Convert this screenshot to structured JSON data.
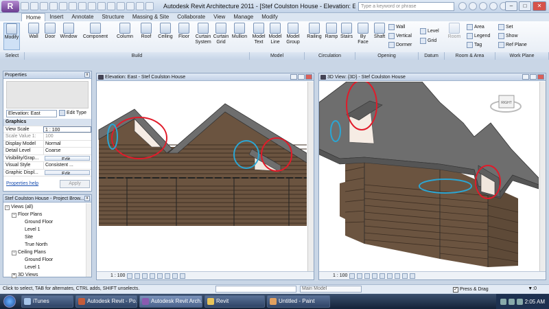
{
  "title_bar": {
    "app_logo": "R",
    "title": "Autodesk Revit Architecture 2011 - [Stef Coulston House - Elevation: E",
    "search_placeholder": "Type a keyword or phrase"
  },
  "tabs": [
    "Home",
    "Insert",
    "Annotate",
    "Structure",
    "Massing & Site",
    "Collaborate",
    "View",
    "Manage",
    "Modify"
  ],
  "ribbon": {
    "select": {
      "modify": "Modify"
    },
    "build": {
      "wall": "Wall",
      "door": "Door",
      "window": "Window",
      "component": "Component",
      "column": "Column",
      "roof": "Roof",
      "ceiling": "Ceiling",
      "floor": "Floor",
      "curtain_system": "Curtain System",
      "curtain_grid": "Curtain Grid",
      "mullion": "Mullion"
    },
    "model": {
      "model_text": "Model Text",
      "model_line": "Model Line",
      "model_group": "Model Group"
    },
    "circulation": {
      "railing": "Railing",
      "ramp": "Ramp",
      "stairs": "Stairs"
    },
    "opening": {
      "by_face": "By Face",
      "shaft": "Shaft",
      "wall": "Wall",
      "vertical": "Vertical",
      "dormer": "Dormer"
    },
    "datum": {
      "level": "Level",
      "grid": "Grid"
    },
    "room_area": {
      "room": "Room",
      "area": "Area",
      "legend": "Legend",
      "tag": "Tag"
    },
    "work_plane": {
      "set": "Set",
      "show": "Show",
      "ref_plane": "Ref Plane"
    },
    "panel_labels": {
      "select": "Select",
      "build": "Build",
      "model": "Model",
      "circulation": "Circulation",
      "opening": "Opening",
      "datum": "Datum",
      "room_area": "Room & Area",
      "work_plane": "Work Plane"
    }
  },
  "properties": {
    "header": "Properties",
    "type_selector": "Elevation: East",
    "edit_type": "Edit Type",
    "rows": [
      {
        "k": "Graphics",
        "v": "",
        "group": true
      },
      {
        "k": "View Scale",
        "v": "1 : 100",
        "style": "box"
      },
      {
        "k": "Scale Value   1:",
        "v": "100",
        "style": "dim"
      },
      {
        "k": "Display Model",
        "v": "Normal"
      },
      {
        "k": "Detail Level",
        "v": "Coarse"
      },
      {
        "k": "Visibility/Grap...",
        "v": "Edit...",
        "style": "btn"
      },
      {
        "k": "Visual Style",
        "v": "Consistent ..."
      },
      {
        "k": "Graphic Displ...",
        "v": "Edit...",
        "style": "btn"
      }
    ],
    "help": "Properties help",
    "apply": "Apply"
  },
  "project_browser": {
    "header": "Stef Coulston House - Project Brow...",
    "nodes": [
      {
        "label": "Views (all)",
        "toggle": "−",
        "indent": 0
      },
      {
        "label": "Floor Plans",
        "toggle": "−",
        "indent": 1
      },
      {
        "label": "Ground Floor",
        "toggle": "",
        "indent": 2
      },
      {
        "label": "Level 1",
        "toggle": "",
        "indent": 2
      },
      {
        "label": "Site",
        "toggle": "",
        "indent": 2
      },
      {
        "label": "True North",
        "toggle": "",
        "indent": 2
      },
      {
        "label": "Ceiling Plans",
        "toggle": "−",
        "indent": 1
      },
      {
        "label": "Ground Floor",
        "toggle": "",
        "indent": 2
      },
      {
        "label": "Level 1",
        "toggle": "",
        "indent": 2
      },
      {
        "label": "3D Views",
        "toggle": "+",
        "indent": 1
      }
    ]
  },
  "views": {
    "elevation": {
      "title": "Elevation: East - Stef Coulston House",
      "scale": "1 : 100"
    },
    "view3d": {
      "title": "3D View: {3D} - Stef Coulston House",
      "scale": "1 : 100",
      "viewcube": "RIGHT"
    }
  },
  "status_bar": {
    "hint": "Click to select, TAB for alternates, CTRL adds, SHIFT unselects.",
    "model": "Main Model",
    "press_drag": "Press & Drag",
    "zero": ":0"
  },
  "taskbar": {
    "items": [
      "iTunes",
      "Autodesk Revit - Po...",
      "Autodesk Revit Arch...",
      "Revit",
      "Untitled - Paint"
    ],
    "clock": "2:05 AM"
  },
  "colors": {
    "roof": "#6e6e6e",
    "siding": "#6b5440",
    "annotation_red": "#e11b2a",
    "annotation_blue": "#2ba6d4"
  }
}
